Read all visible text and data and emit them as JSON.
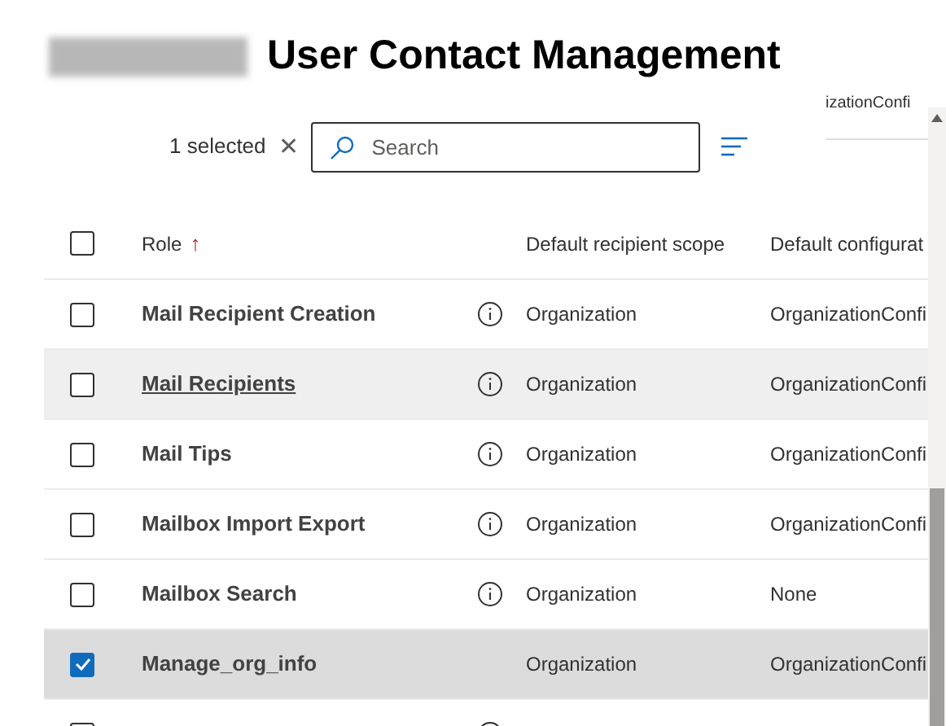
{
  "title": "User Contact Management",
  "side_panel_text": "izationConfi",
  "toolbar": {
    "selection_count": "1 selected",
    "clear_icon": "✕",
    "search": {
      "placeholder": "Search"
    }
  },
  "table": {
    "header_checked": false,
    "columns": [
      {
        "label": "Role",
        "sort_arrow": "↑"
      },
      {
        "label": "Default recipient scope"
      },
      {
        "label": "Default configurat"
      }
    ],
    "rows": [
      {
        "role": "Mail Recipient Creation",
        "info": true,
        "scope": "Organization",
        "config": "OrganizationConfi",
        "checked": false,
        "selected": false,
        "hovered": false
      },
      {
        "role": "Mail Recipients",
        "info": true,
        "scope": "Organization",
        "config": "OrganizationConfi",
        "checked": false,
        "selected": false,
        "hovered": true
      },
      {
        "role": "Mail Tips",
        "info": true,
        "scope": "Organization",
        "config": "OrganizationConfi",
        "checked": false,
        "selected": false,
        "hovered": false
      },
      {
        "role": "Mailbox Import Export",
        "info": true,
        "scope": "Organization",
        "config": "OrganizationConfi",
        "checked": false,
        "selected": false,
        "hovered": false
      },
      {
        "role": "Mailbox Search",
        "info": true,
        "scope": "Organization",
        "config": "None",
        "checked": false,
        "selected": false,
        "hovered": false
      },
      {
        "role": "Manage_org_info",
        "info": false,
        "scope": "Organization",
        "config": "OrganizationConfi",
        "checked": true,
        "selected": true,
        "hovered": false
      },
      {
        "info": true,
        "checked": false,
        "selected": false,
        "hovered": false
      }
    ]
  }
}
